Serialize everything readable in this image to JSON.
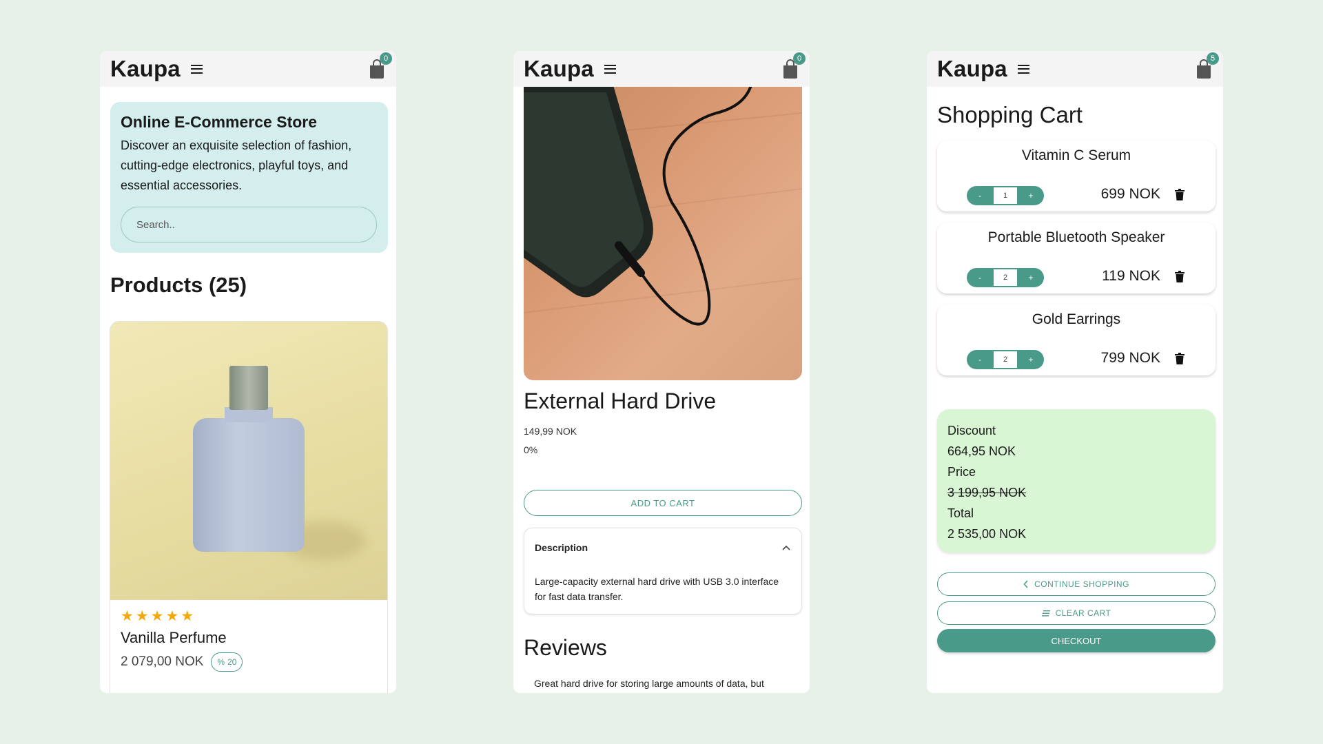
{
  "screens": {
    "home": {
      "brand": "Kaupa",
      "cart_count": "0",
      "hero": {
        "title": "Online E-Commerce Store",
        "text": "Discover an exquisite selection of fashion, cutting-edge electronics, playful toys, and essential accessories.",
        "search_placeholder": "Search.."
      },
      "products_title": "Products (25)",
      "product": {
        "name": "Vanilla Perfume",
        "price": "2 079,00 NOK",
        "discount": "20",
        "rating": 5
      }
    },
    "product": {
      "brand": "Kaupa",
      "cart_count": "0",
      "title": "External Hard Drive",
      "price": "149,99 NOK",
      "discount": "0%",
      "add_to_cart": "ADD TO CART",
      "description": {
        "label": "Description",
        "text": "Large-capacity external hard drive with USB 3.0 interface for fast data transfer."
      },
      "reviews_title": "Reviews",
      "review_preview": "Great hard drive for storing large amounts of data, but"
    },
    "cart": {
      "brand": "Kaupa",
      "cart_count": "5",
      "title": "Shopping Cart",
      "items": [
        {
          "name": "Vitamin C Serum",
          "qty": "1",
          "price": "699 NOK"
        },
        {
          "name": "Portable Bluetooth Speaker",
          "qty": "2",
          "price": "119 NOK"
        },
        {
          "name": "Gold Earrings",
          "qty": "2",
          "price": "799 NOK"
        }
      ],
      "stepper": {
        "minus": "-",
        "plus": "+"
      },
      "summary": {
        "discount_label": "Discount",
        "discount_value": "664,95 NOK",
        "price_label": "Price",
        "price_value": "3 199,95 NOK",
        "total_label": "Total",
        "total_value": "2 535,00 NOK"
      },
      "continue_label": "CONTINUE SHOPPING",
      "clear_label": "CLEAR CART",
      "checkout_label": "CHECKOUT"
    }
  },
  "colors": {
    "page_bg": "#e8f1e8",
    "accent": "#4a9a8a",
    "hero_bg": "#d3eeec",
    "summary_bg": "#d8f5d4",
    "star": "#f4a80a"
  },
  "icons": [
    "menu-icon",
    "shopping-bag-icon",
    "percent-icon",
    "chevron-up-icon",
    "chevron-left-icon",
    "list-icon",
    "trash-icon",
    "star-icon"
  ]
}
